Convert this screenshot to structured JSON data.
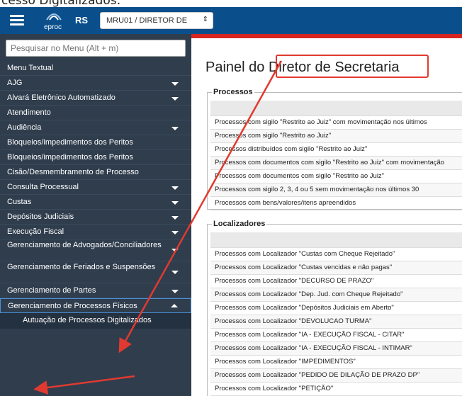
{
  "caption": "cesso Digitalizados:",
  "topbar": {
    "logo_text": "eproc",
    "state": "RS",
    "profile_select": "MRU01 / DIRETOR DE"
  },
  "sidebar": {
    "search_placeholder": "Pesquisar no Menu (Alt + m)",
    "items": [
      {
        "label": "Menu Textual",
        "expandable": false
      },
      {
        "label": "AJG",
        "expandable": true
      },
      {
        "label": "Alvará Eletrônico Automatizado",
        "expandable": true
      },
      {
        "label": "Atendimento",
        "expandable": false
      },
      {
        "label": "Audiência",
        "expandable": true
      },
      {
        "label": "Bloqueios/impedimentos dos Peritos",
        "expandable": false
      },
      {
        "label": "Bloqueios/impedimentos dos Peritos",
        "expandable": false
      },
      {
        "label": "Cisão/Desmembramento de Processo",
        "expandable": false
      },
      {
        "label": "Consulta Processual",
        "expandable": true
      },
      {
        "label": "Custas",
        "expandable": true
      },
      {
        "label": "Depósitos Judiciais",
        "expandable": true
      },
      {
        "label": "Execução Fiscal",
        "expandable": true
      },
      {
        "label": "Gerenciamento de Advogados/Conciliadores",
        "expandable": true
      },
      {
        "label": "Gerenciamento de Feriados e Suspensões",
        "expandable": true
      },
      {
        "label": "Gerenciamento de Partes",
        "expandable": true
      },
      {
        "label": "Gerenciamento de Processos Físicos",
        "expandable": true
      }
    ],
    "subitem": "Autuação de Processos Digitalizados"
  },
  "main": {
    "title": "Painel do Diretor de Secretaria",
    "processos": {
      "legend": "Processos",
      "rows": [
        "Processos com sigilo \"Restrito ao Juiz\" com movimentação nos últimos",
        "Processos com sigilo \"Restrito ao Juiz\"",
        "Processos distribuídos com sigilo \"Restrito ao Juiz\"",
        "Processos com documentos com sigilo \"Restrito ao Juiz\" com movimentação",
        "Processos com documentos com sigilo \"Restrito ao Juiz\"",
        "Processos com sigilo 2, 3, 4 ou 5 sem movimentação nos últimos 30",
        "Processos com bens/valores/itens apreendidos"
      ]
    },
    "localizadores": {
      "legend": "Localizadores",
      "rows": [
        "Processos com Localizador  \"Custas com Cheque Rejeitado\"",
        "Processos com Localizador  \"Custas vencidas e não pagas\"",
        "Processos com Localizador  \"DECURSO DE PRAZO\"",
        "Processos com Localizador  \"Dep. Jud. com Cheque Rejeitado\"",
        "Processos com Localizador  \"Depósitos Judiciais em Aberto\"",
        "Processos com Localizador  \"DEVOLUCAO TURMA\"",
        "Processos com Localizador  \"IA - EXECUÇÃO FISCAL - CITAR\"",
        "Processos com Localizador  \"IA - EXECUÇÃO FISCAL - INTIMAR\"",
        "Processos com Localizador  \"IMPEDIMENTOS\"",
        "Processos com Localizador  \"PEDIDO DE DILAÇÃO DE PRAZO DP\"",
        "Processos com Localizador  \"PETIÇÃO\""
      ]
    }
  },
  "colors": {
    "topbar": "#0a4f8c",
    "accent_red": "#d6261f",
    "sidebar_bg": "#2f3d4d",
    "annotation": "#e03a30"
  }
}
